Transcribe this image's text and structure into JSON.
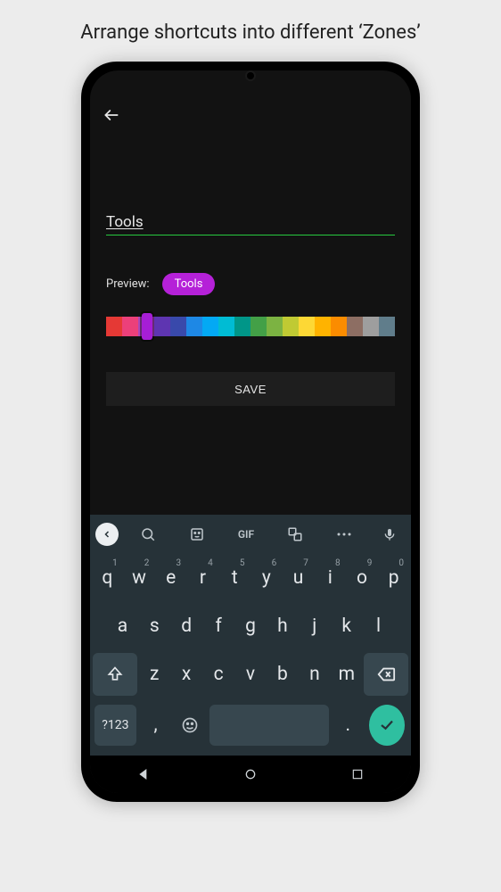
{
  "caption": "Arrange shortcuts into different ‘Zones’",
  "form": {
    "zone_name": "Tools",
    "preview_label": "Preview:",
    "preview_chip": "Tools",
    "save_label": "SAVE"
  },
  "color_picker": {
    "colors": [
      "#e53935",
      "#ec407a",
      "#ab47bc",
      "#5e35b1",
      "#3949ab",
      "#1e88e5",
      "#03a9f4",
      "#00bcd4",
      "#009688",
      "#43a047",
      "#7cb342",
      "#c0ca33",
      "#fdd835",
      "#ffb300",
      "#fb8c00",
      "#8d6e63",
      "#9e9e9e",
      "#607d8b"
    ],
    "selected_index": 2
  },
  "keyboard": {
    "rows": [
      [
        {
          "k": "q",
          "n": "1"
        },
        {
          "k": "w",
          "n": "2"
        },
        {
          "k": "e",
          "n": "3"
        },
        {
          "k": "r",
          "n": "4"
        },
        {
          "k": "t",
          "n": "5"
        },
        {
          "k": "y",
          "n": "6"
        },
        {
          "k": "u",
          "n": "7"
        },
        {
          "k": "i",
          "n": "8"
        },
        {
          "k": "o",
          "n": "9"
        },
        {
          "k": "p",
          "n": "0"
        }
      ],
      [
        {
          "k": "a"
        },
        {
          "k": "s"
        },
        {
          "k": "d"
        },
        {
          "k": "f"
        },
        {
          "k": "g"
        },
        {
          "k": "h"
        },
        {
          "k": "j"
        },
        {
          "k": "k"
        },
        {
          "k": "l"
        }
      ],
      [
        {
          "k": "z"
        },
        {
          "k": "x"
        },
        {
          "k": "c"
        },
        {
          "k": "v"
        },
        {
          "k": "b"
        },
        {
          "k": "n"
        },
        {
          "k": "m"
        }
      ]
    ],
    "numsym": "?123",
    "comma": ",",
    "period": ".",
    "gif": "GIF"
  }
}
